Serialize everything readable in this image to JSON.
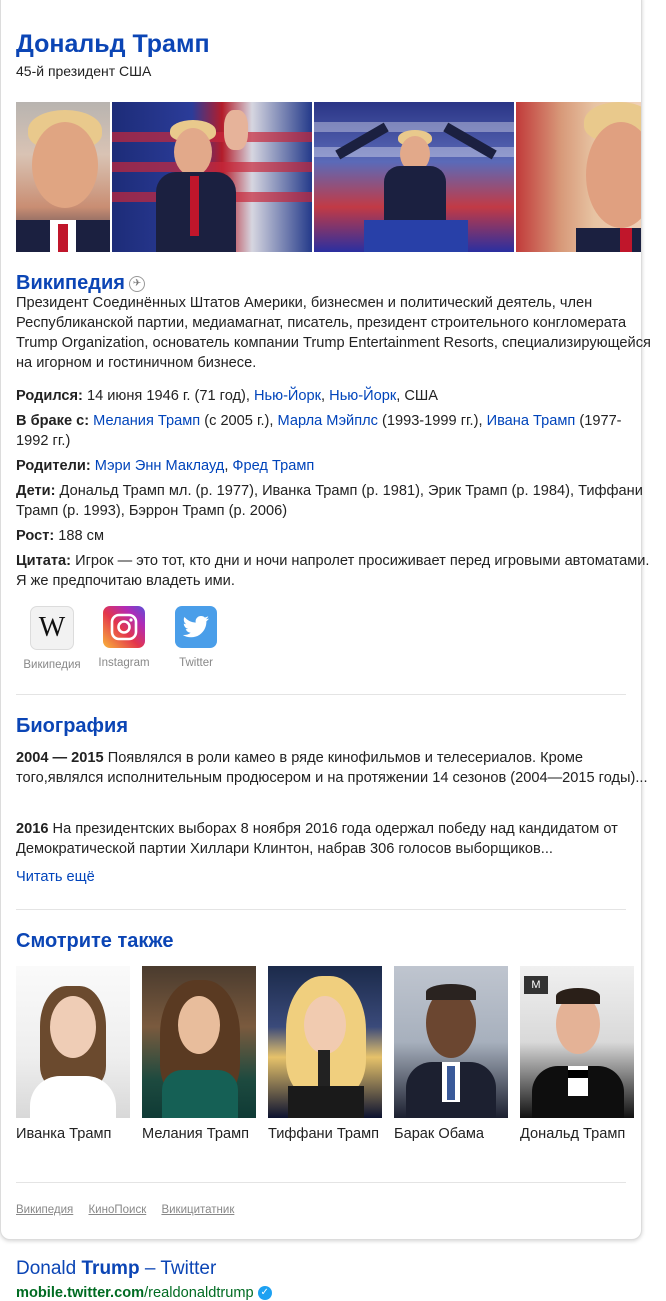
{
  "entity": {
    "title": "Дональд Трамп",
    "subtitle": "45-й президент США"
  },
  "wiki": {
    "heading": "Википедия",
    "description": "Президент Соединённых Штатов Америки, бизнесмен и политический деятель, член Республиканской партии, медиамагнат, писатель, президент строительного конгломерата Trump Organization, основатель компании Trump Entertainment Resorts, специализирующейся на игорном и гостиничном бизнесе.",
    "facts": {
      "born": {
        "label": "Родился:",
        "date": "14 июня 1946 г. (71 год),",
        "link1": "Нью-Йорк",
        "link2": "Нью-Йорк",
        "country": "США"
      },
      "spouse": {
        "label": "В браке с:",
        "s1": "Мелания Трамп",
        "s1_years": "(с 2005 г.),",
        "s2": "Марла Мэйплс",
        "s2_years": "(1993-1999 гг.),",
        "s3": "Ивана Трамп",
        "s3_years": "(1977-1992 гг.)"
      },
      "parents": {
        "label": "Родители:",
        "p1": "Мэри Энн Маклауд",
        "p2": "Фред Трамп"
      },
      "children": {
        "label": "Дети:",
        "value": "Дональд Трамп мл. (р. 1977), Иванка Трамп (р. 1981), Эрик Трамп (р. 1984), Тиффани Трамп (р. 1993), Бэррон Трамп (р. 2006)"
      },
      "height": {
        "label": "Рост:",
        "value": "188 см"
      },
      "quote": {
        "label": "Цитата:",
        "value": "Игрок — это тот, кто дни и ночи напролет просиживает перед игровыми автоматами. Я же предпочитаю владеть ими."
      }
    }
  },
  "socials": [
    {
      "label": "Википедия",
      "icon": "wikipedia-icon"
    },
    {
      "label": "Instagram",
      "icon": "instagram-icon"
    },
    {
      "label": "Twitter",
      "icon": "twitter-icon"
    }
  ],
  "bio": {
    "heading": "Биография",
    "items": [
      {
        "years": "2004 — 2015",
        "text": "Появлялся в роли камео в ряде кинофильмов и телесериалов. Кроме того,являлся исполнительным продюсером и на протяжении 14 сезонов (2004—2015 годы)..."
      },
      {
        "years": "2016",
        "text": "На президентских выборах 8 ноября 2016 года одержал победу над кандидатом от Демократической партии Хиллари Клинтон, набрав 306 голосов выборщиков..."
      }
    ],
    "read_more": "Читать ещё"
  },
  "see_also": {
    "heading": "Смотрите также",
    "people": [
      "Иванка Трамп",
      "Мелания Трамп",
      "Тиффани Трамп",
      "Барак Обама",
      "Дональд Трамп"
    ]
  },
  "sources": [
    "Википедия",
    "КиноПоиск",
    "Викицитатник"
  ],
  "result": {
    "title_prefix": "Donald",
    "title_bold": "Trump",
    "title_suffix": "– Twitter",
    "url_bold": "mobile.twitter.com",
    "url_rest": "/realdonaldtrump"
  },
  "colors": {
    "link": "#0044bb",
    "heading": "#0b45b5",
    "url_green": "#006b22"
  }
}
